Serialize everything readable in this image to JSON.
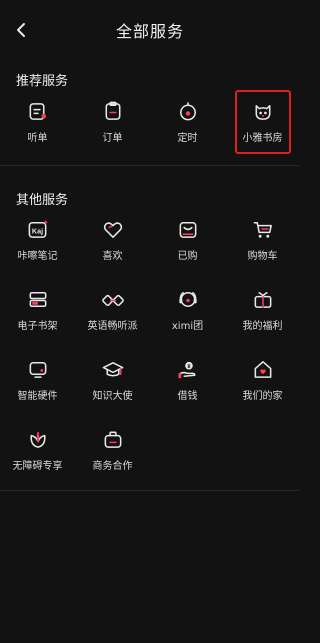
{
  "header": {
    "title": "全部服务"
  },
  "recommended": {
    "title": "推荐服务",
    "items": [
      {
        "label": "听单",
        "icon": "playlist-icon"
      },
      {
        "label": "订单",
        "icon": "order-icon"
      },
      {
        "label": "定时",
        "icon": "timer-icon"
      },
      {
        "label": "小雅书房",
        "icon": "xiaoya-cat-icon"
      }
    ]
  },
  "others": {
    "title": "其他服务",
    "items": [
      {
        "label": "咔嚓笔记",
        "icon": "kaji-note-icon"
      },
      {
        "label": "喜欢",
        "icon": "heart-icon"
      },
      {
        "label": "已购",
        "icon": "purchased-box-icon"
      },
      {
        "label": "购物车",
        "icon": "shopping-cart-icon"
      },
      {
        "label": "电子书架",
        "icon": "bookshelf-icon"
      },
      {
        "label": "英语畅听派",
        "icon": "english-listening-icon"
      },
      {
        "label": "ximi团",
        "icon": "ximi-group-icon"
      },
      {
        "label": "我的福利",
        "icon": "gift-icon"
      },
      {
        "label": "智能硬件",
        "icon": "smart-hardware-icon"
      },
      {
        "label": "知识大使",
        "icon": "graduation-cap-icon"
      },
      {
        "label": "借钱",
        "icon": "loan-hand-coin-icon"
      },
      {
        "label": "我们的家",
        "icon": "home-heart-icon"
      },
      {
        "label": "无障碍专享",
        "icon": "accessibility-leaf-icon"
      },
      {
        "label": "商务合作",
        "icon": "business-bag-icon"
      }
    ]
  },
  "colors": {
    "accent": "#ff3b5c",
    "background": "#121212",
    "highlight_box": "#e02020"
  }
}
